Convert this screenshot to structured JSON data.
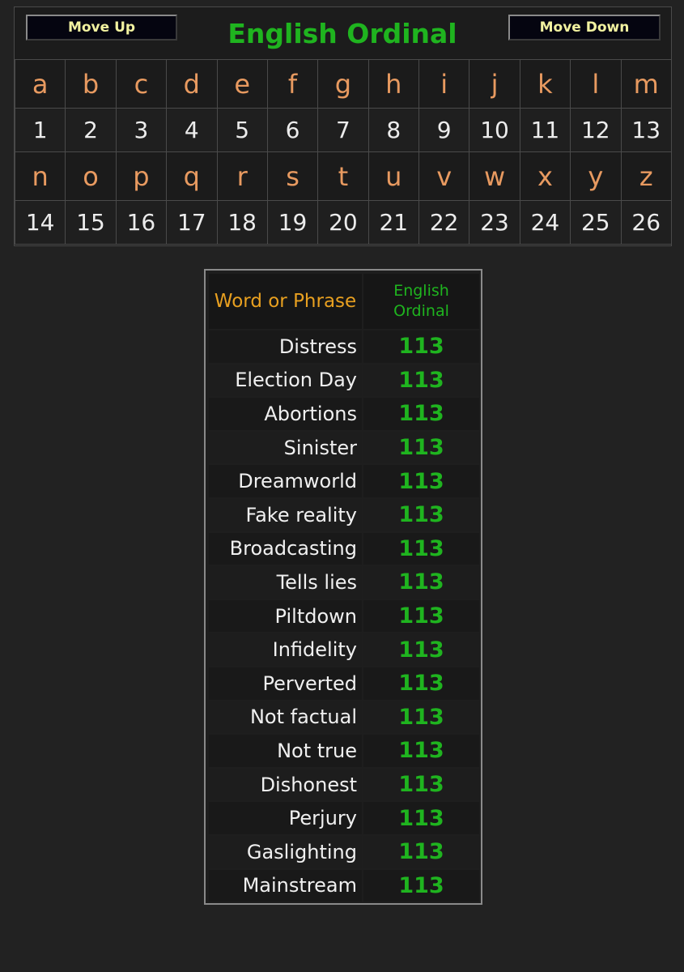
{
  "header": {
    "title": "English Ordinal",
    "move_up_label": "Move Up",
    "move_down_label": "Move Down"
  },
  "cipher": {
    "row1_letters": [
      "a",
      "b",
      "c",
      "d",
      "e",
      "f",
      "g",
      "h",
      "i",
      "j",
      "k",
      "l",
      "m"
    ],
    "row1_values": [
      "1",
      "2",
      "3",
      "4",
      "5",
      "6",
      "7",
      "8",
      "9",
      "10",
      "11",
      "12",
      "13"
    ],
    "row2_letters": [
      "n",
      "o",
      "p",
      "q",
      "r",
      "s",
      "t",
      "u",
      "v",
      "w",
      "x",
      "y",
      "z"
    ],
    "row2_values": [
      "14",
      "15",
      "16",
      "17",
      "18",
      "19",
      "20",
      "21",
      "22",
      "23",
      "24",
      "25",
      "26"
    ]
  },
  "results": {
    "word_header": "Word or Phrase",
    "value_header_line1": "English",
    "value_header_line2": "Ordinal",
    "rows": [
      {
        "word": "Distress",
        "value": "113"
      },
      {
        "word": "Election Day",
        "value": "113"
      },
      {
        "word": "Abortions",
        "value": "113"
      },
      {
        "word": "Sinister",
        "value": "113"
      },
      {
        "word": "Dreamworld",
        "value": "113"
      },
      {
        "word": "Fake reality",
        "value": "113"
      },
      {
        "word": "Broadcasting",
        "value": "113"
      },
      {
        "word": "Tells lies",
        "value": "113"
      },
      {
        "word": "Piltdown",
        "value": "113"
      },
      {
        "word": "Infidelity",
        "value": "113"
      },
      {
        "word": "Perverted",
        "value": "113"
      },
      {
        "word": "Not factual",
        "value": "113"
      },
      {
        "word": "Not true",
        "value": "113"
      },
      {
        "word": "Dishonest",
        "value": "113"
      },
      {
        "word": "Perjury",
        "value": "113"
      },
      {
        "word": "Gaslighting",
        "value": "113"
      },
      {
        "word": "Mainstream",
        "value": "113"
      }
    ]
  },
  "colors": {
    "background": "#222222",
    "accent_green": "#1fb41f",
    "letter_orange": "#e89a60",
    "header_orange": "#e8a020",
    "button_text": "#f2f2a0"
  }
}
